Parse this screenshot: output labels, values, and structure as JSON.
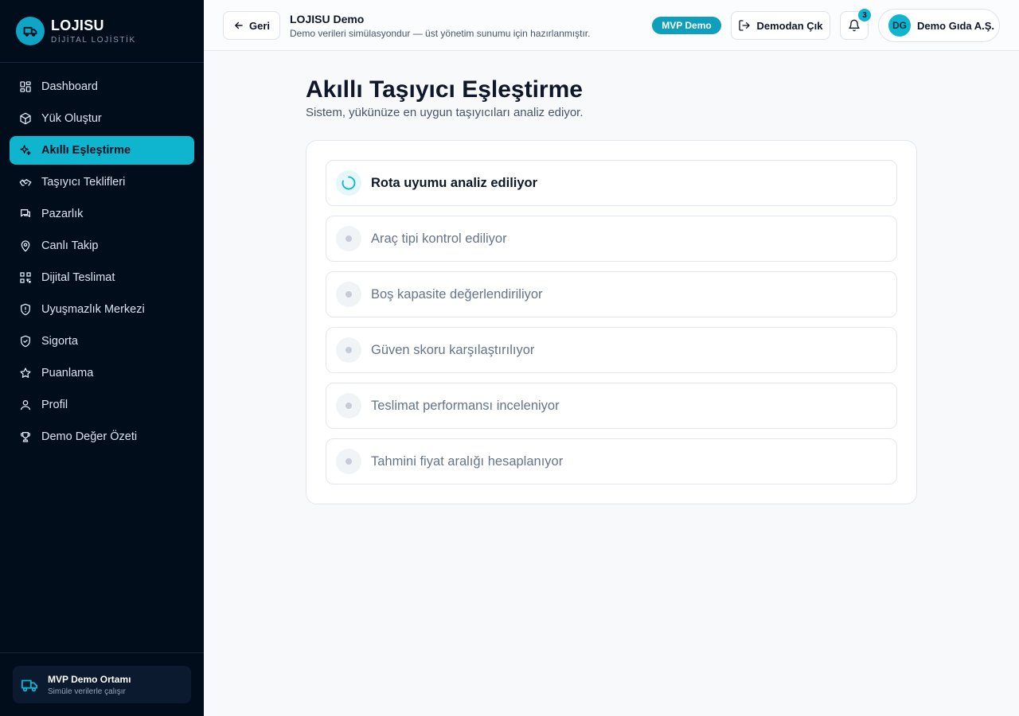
{
  "brand": {
    "name": "LOJISU",
    "subtitle": "DİJİTAL LOJİSTİK",
    "accent": "#0fb4cf"
  },
  "sidebar": {
    "items": [
      {
        "label": "Dashboard",
        "icon": "dashboard-icon",
        "active": false
      },
      {
        "label": "Yük Oluştur",
        "icon": "package-icon",
        "active": false
      },
      {
        "label": "Akıllı Eşleştirme",
        "icon": "sparkles-icon",
        "active": true
      },
      {
        "label": "Taşıyıcı Teklifleri",
        "icon": "handshake-icon",
        "active": false
      },
      {
        "label": "Pazarlık",
        "icon": "chat-icon",
        "active": false
      },
      {
        "label": "Canlı Takip",
        "icon": "map-pin-icon",
        "active": false
      },
      {
        "label": "Dijital Teslimat",
        "icon": "qr-code-icon",
        "active": false
      },
      {
        "label": "Uyuşmazlık Merkezi",
        "icon": "shield-alert-icon",
        "active": false
      },
      {
        "label": "Sigorta",
        "icon": "shield-check-icon",
        "active": false
      },
      {
        "label": "Puanlama",
        "icon": "star-icon",
        "active": false
      },
      {
        "label": "Profil",
        "icon": "user-icon",
        "active": false
      },
      {
        "label": "Demo Değer Özeti",
        "icon": "trophy-icon",
        "active": false
      }
    ],
    "footer": {
      "title": "MVP Demo Ortamı",
      "subtitle": "Simüle verilerle çalışır"
    }
  },
  "header": {
    "back_label": "Geri",
    "title": "LOJISU Demo",
    "subtitle": "Demo verileri simülasyondur — üst yönetim sunumu için hazırlanmıştır.",
    "badge": "MVP Demo",
    "exit_label": "Demodan Çık",
    "notification_count": "3",
    "user_initials": "DG",
    "user_name": "Demo Gıda A.Ş."
  },
  "main": {
    "title": "Akıllı Taşıyıcı Eşleştirme",
    "subtitle": "Sistem, yükünüze en uygun taşıyıcıları analiz ediyor.",
    "steps": [
      {
        "label": "Rota uyumu analiz ediliyor",
        "state": "active"
      },
      {
        "label": "Araç tipi kontrol ediliyor",
        "state": "pending"
      },
      {
        "label": "Boş kapasite değerlendiriliyor",
        "state": "pending"
      },
      {
        "label": "Güven skoru karşılaştırılıyor",
        "state": "pending"
      },
      {
        "label": "Teslimat performansı inceleniyor",
        "state": "pending"
      },
      {
        "label": "Tahmini fiyat aralığı hesaplanıyor",
        "state": "pending"
      }
    ]
  }
}
